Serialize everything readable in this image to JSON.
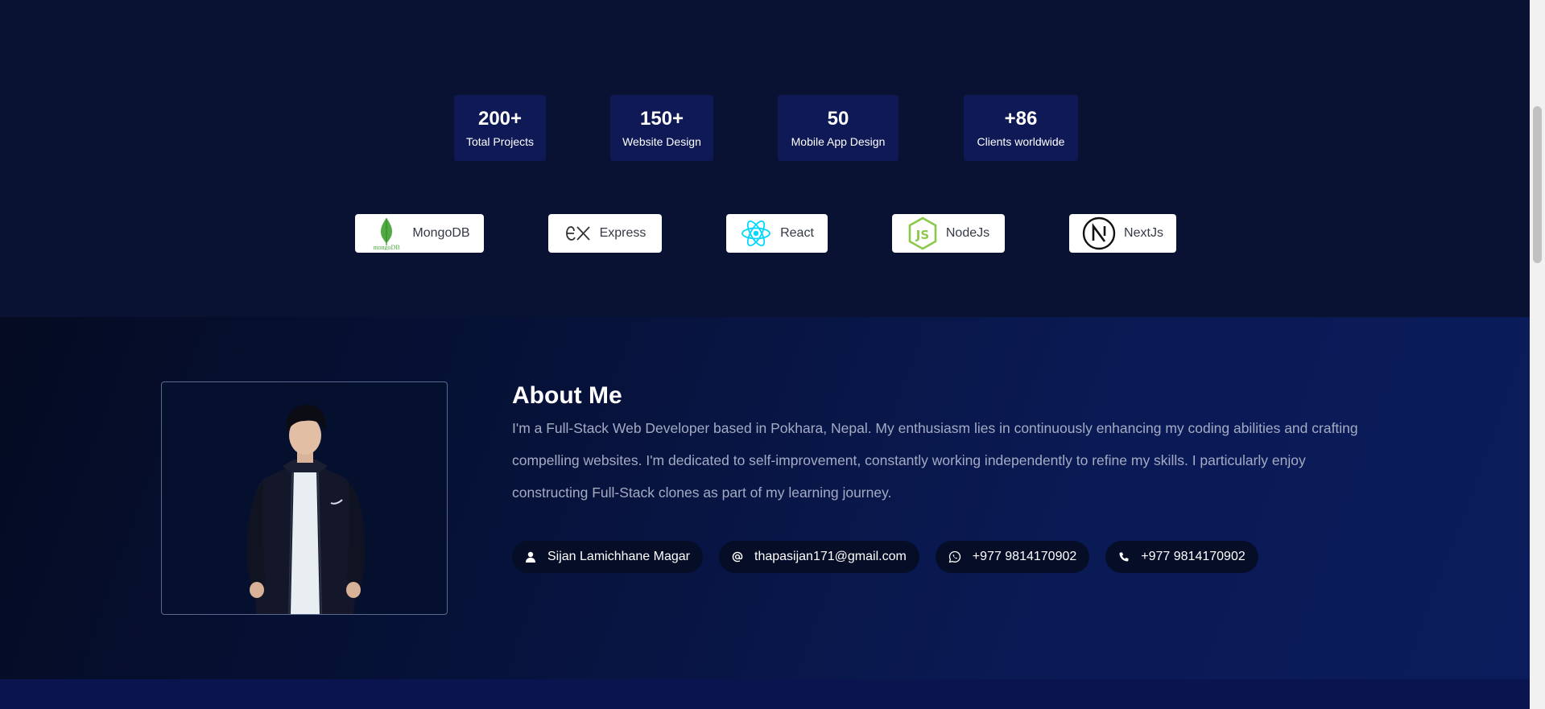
{
  "stats": [
    {
      "value": "200+",
      "label": "Total Projects"
    },
    {
      "value": "150+",
      "label": "Website Design"
    },
    {
      "value": "50",
      "label": "Mobile App Design"
    },
    {
      "value": "+86",
      "label": "Clients worldwide"
    }
  ],
  "tech": [
    {
      "label": "MongoDB",
      "icon": "mongodb-icon",
      "icon_caption": "mongoDB"
    },
    {
      "label": "Express",
      "icon": "express-icon"
    },
    {
      "label": "React",
      "icon": "react-icon"
    },
    {
      "label": "NodeJs",
      "icon": "nodejs-icon"
    },
    {
      "label": "NextJs",
      "icon": "nextjs-icon"
    }
  ],
  "about": {
    "title": "About Me",
    "description": "I'm a Full-Stack Web Developer based in Pokhara, Nepal. My enthusiasm lies in continuously enhancing my coding abilities and crafting compelling websites. I'm dedicated to self-improvement, constantly working independently to refine my skills. I particularly enjoy constructing Full-Stack clones as part of my learning journey.",
    "contacts": [
      {
        "icon": "user-icon",
        "text": "Sijan Lamichhane Magar"
      },
      {
        "icon": "at-icon",
        "text": "thapasijan171@gmail.com"
      },
      {
        "icon": "whatsapp-icon",
        "text": "+977 9814170902"
      },
      {
        "icon": "phone-icon",
        "text": "+977 9814170902"
      }
    ]
  },
  "colors": {
    "page_bg": "#0a1233",
    "stat_card_bg": "#0e1955",
    "chip_bg": "#060d26",
    "mongodb_green": "#4faa41",
    "react_blue": "#00d8ff",
    "node_green": "#8cc84b"
  }
}
